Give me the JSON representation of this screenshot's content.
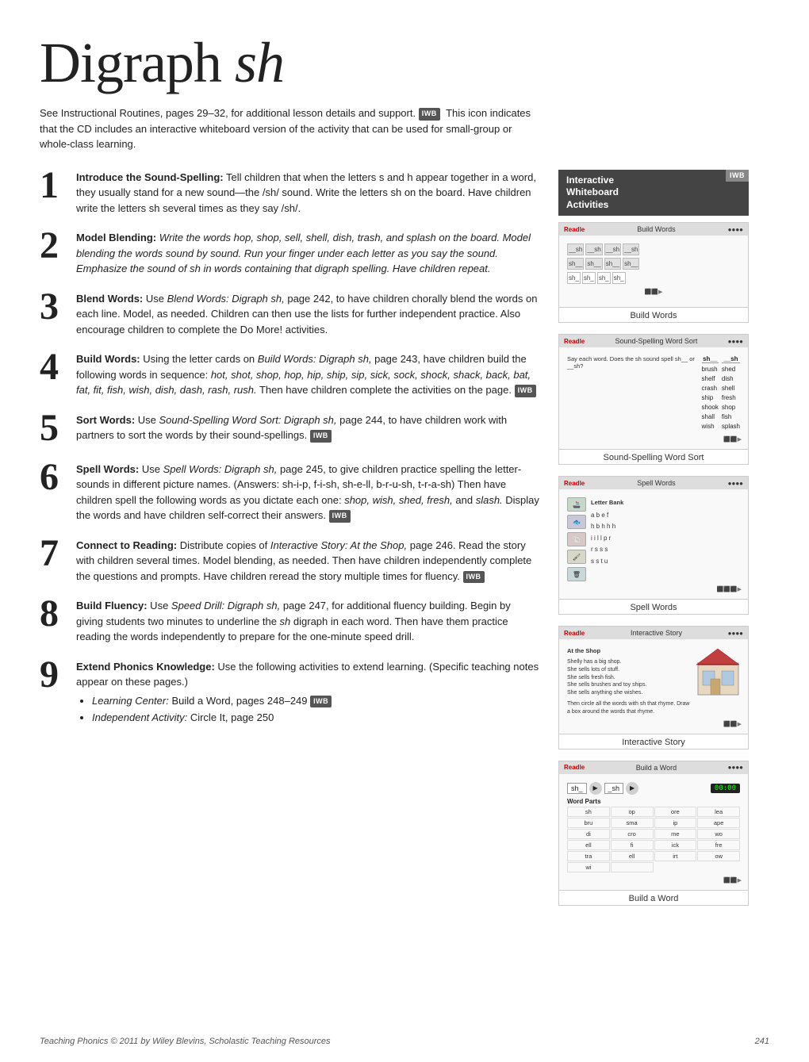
{
  "page": {
    "title_plain": "Digraph ",
    "title_italic": "sh",
    "footer_left": "Teaching Phonics © 2011 by Wiley Blevins, Scholastic Teaching Resources",
    "footer_right": "241"
  },
  "intro": {
    "text": "See Instructional Routines, pages 29–32, for additional lesson details and support.",
    "iwb_label": "IWB",
    "iwb_text": " This icon indicates that the CD includes an interactive whiteboard version of the activity that can be used for small-group or whole-class learning."
  },
  "sidebar": {
    "title_line1": "Interactive",
    "title_line2": "Whiteboard",
    "title_line3": "Activities",
    "iwb_corner": "IWB",
    "cards": [
      {
        "id": "build-words",
        "app_name": "Readle",
        "header_title": "Build Words",
        "caption": "Build Words"
      },
      {
        "id": "sound-spelling",
        "app_name": "Readle",
        "header_title": "Sound-Spelling Word Sort",
        "caption": "Sound-Spelling Word Sort",
        "col1_header": "sh__",
        "col2_header": "__sh",
        "words_col1": [
          "brush",
          "shelf",
          "crash",
          "ship",
          "shook",
          "shall",
          "wish"
        ],
        "words_col2": [
          "shed",
          "dish",
          "shell",
          "fresh",
          "shop",
          "fish",
          "splash"
        ]
      },
      {
        "id": "spell-words",
        "app_name": "Readle",
        "header_title": "Spell Words",
        "caption": "Spell Words",
        "letter_bank": "abef hbhhh iillpr rsss sstu"
      },
      {
        "id": "interactive-story",
        "app_name": "Readle",
        "header_title": "Interactive Story",
        "caption": "Interactive Story",
        "story_title": "At the Shop",
        "story_text": "Shelly has a big shop. She sells lots of stuff. She sells fresh fish. She sells brushes and toy ships. She sells anything she wishes."
      },
      {
        "id": "build-a-word",
        "app_name": "Readle",
        "header_title": "Build a Word",
        "caption": "Build a Word",
        "timer": "00:00",
        "slots": [
          "sh_",
          "",
          "_sh",
          ""
        ],
        "word_parts_label": "Word Parts",
        "word_parts": [
          "sh",
          "op",
          "ore",
          "lea",
          "bru",
          "sma",
          "ip",
          "ape",
          "di",
          "cro",
          "me",
          "wo",
          "ell",
          "fi",
          "ick",
          "fre",
          "tra",
          "ell",
          "irt",
          "ow",
          "wi"
        ]
      }
    ]
  },
  "steps": [
    {
      "number": "1",
      "title": "Introduce the Sound-Spelling:",
      "body": " Tell children that when the letters s and h appear together in a word, they usually stand for a new sound—the /sh/ sound. Write the letters sh on the board. Have children write the letters sh several times as they say /sh/."
    },
    {
      "number": "2",
      "title": "Model Blending:",
      "body": " Write the words hop, shop, sell, shell, dish, trash, and splash on the board. Model blending the words sound by sound. Run your finger under each letter as you say the sound. Emphasize the sound of sh in words containing that digraph spelling. Have children repeat."
    },
    {
      "number": "3",
      "title": "Blend Words:",
      "body": " Use Blend Words: Digraph sh, page 242, to have children chorally blend the words on each line. Model, as needed. Children can then use the lists for further independent practice. Also encourage children to complete the Do More! activities."
    },
    {
      "number": "4",
      "title": "Build Words:",
      "body": " Using the letter cards on Build Words: Digraph sh, page 243, have children build the following words in sequence: hot, shot, shop, hop, hip, ship, sip, sick, sock, shock, shack, back, bat, fat, fit, fish, wish, dish, dash, rash, rush. Then have children complete the activities on the page.",
      "has_iwb": true
    },
    {
      "number": "5",
      "title": "Sort Words:",
      "body": " Use Sound-Spelling Word Sort: Digraph sh, page 244, to have children work with partners to sort the words by their sound-spellings.",
      "has_iwb": true
    },
    {
      "number": "6",
      "title": "Spell Words:",
      "body": " Use Spell Words: Digraph sh, page 245, to give children practice spelling the letter-sounds in different picture names. (Answers: sh-i-p, f-i-sh, sh-e-ll, b-r-u-sh, t-r-a-sh) Then have children spell the following words as you dictate each one: shop, wish, shed, fresh, and slash. Display the words and have children self-correct their answers.",
      "has_iwb": true
    },
    {
      "number": "7",
      "title": "Connect to Reading:",
      "body": " Distribute copies of Interactive Story: At the Shop, page 246. Read the story with children several times. Model blending, as needed. Then have children independently complete the questions and prompts. Have children reread the story multiple times for fluency.",
      "has_iwb": true
    },
    {
      "number": "8",
      "title": "Build Fluency:",
      "body": " Use Speed Drill: Digraph sh, page 247, for additional fluency building. Begin by giving students two minutes to underline the sh digraph in each word. Then have them practice reading the words independently to prepare for the one-minute speed drill."
    },
    {
      "number": "9",
      "title": "Extend Phonics Knowledge:",
      "body": " Use the following activities to extend learning. (Specific teaching notes appear on these pages.)",
      "bullets": [
        "Learning Center: Build a Word, pages 248–249",
        "Independent Activity: Circle It, page 250"
      ],
      "bullet1_has_iwb": true
    }
  ],
  "iwb_badge": "IWB",
  "build_word_label": "Build Word"
}
